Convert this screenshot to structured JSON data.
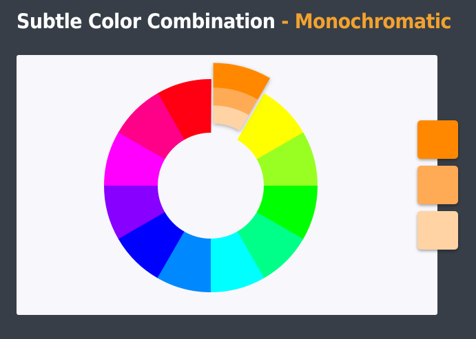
{
  "title": {
    "main": "Subtle Color Combination",
    "separator": "-",
    "accent": "Monochromatic",
    "accent_color": "#f2a22e"
  },
  "wheel": {
    "segments": [
      {
        "name": "red",
        "color": "#ff0012"
      },
      {
        "name": "orange",
        "color": "#ff8800",
        "highlighted": true,
        "tints": [
          "#ff8800",
          "#ffaa55",
          "#ffd3a4"
        ]
      },
      {
        "name": "yellow",
        "color": "#ffff00"
      },
      {
        "name": "yellow-green",
        "color": "#99ff22"
      },
      {
        "name": "green",
        "color": "#00ff00"
      },
      {
        "name": "spring-green",
        "color": "#00ff88"
      },
      {
        "name": "cyan",
        "color": "#00ffff"
      },
      {
        "name": "azure",
        "color": "#0088ff"
      },
      {
        "name": "blue",
        "color": "#0000ff"
      },
      {
        "name": "violet",
        "color": "#8800ff"
      },
      {
        "name": "magenta",
        "color": "#ff00ff"
      },
      {
        "name": "rose",
        "color": "#ff0088"
      }
    ]
  },
  "swatches": [
    {
      "name": "orange",
      "color": "#ff8800"
    },
    {
      "name": "light-orange",
      "color": "#ffaa55"
    },
    {
      "name": "pale-orange",
      "color": "#ffd3a4"
    }
  ]
}
